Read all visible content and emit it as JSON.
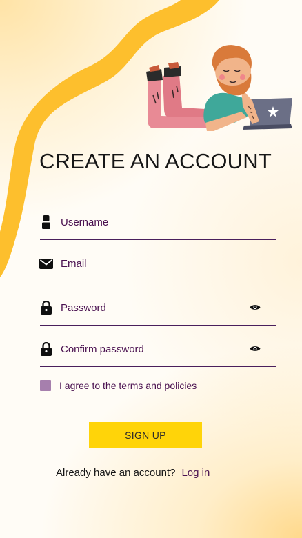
{
  "page": {
    "title": "CREATE AN ACCOUNT"
  },
  "form": {
    "username": {
      "placeholder": "Username",
      "value": "",
      "icon": "user-icon"
    },
    "email": {
      "placeholder": "Email",
      "value": "",
      "icon": "envelope-icon"
    },
    "password": {
      "placeholder": "Password",
      "value": "",
      "icon": "lock-icon",
      "toggle_icon": "eye-icon"
    },
    "confirm_password": {
      "placeholder": "Confirm password",
      "value": "",
      "icon": "lock-icon",
      "toggle_icon": "eye-icon"
    },
    "terms": {
      "label": "I agree to the terms and policies",
      "checked": false
    },
    "signup_label": "SIGN UP"
  },
  "footer": {
    "question": "Already have an account?",
    "login_link": "Log in"
  },
  "colors": {
    "accent_yellow": "#ffd409",
    "wave_yellow": "#fdbf2d",
    "text_purple": "#4a1150",
    "checkbox_purple": "#a67fad",
    "title_dark": "#161616"
  }
}
